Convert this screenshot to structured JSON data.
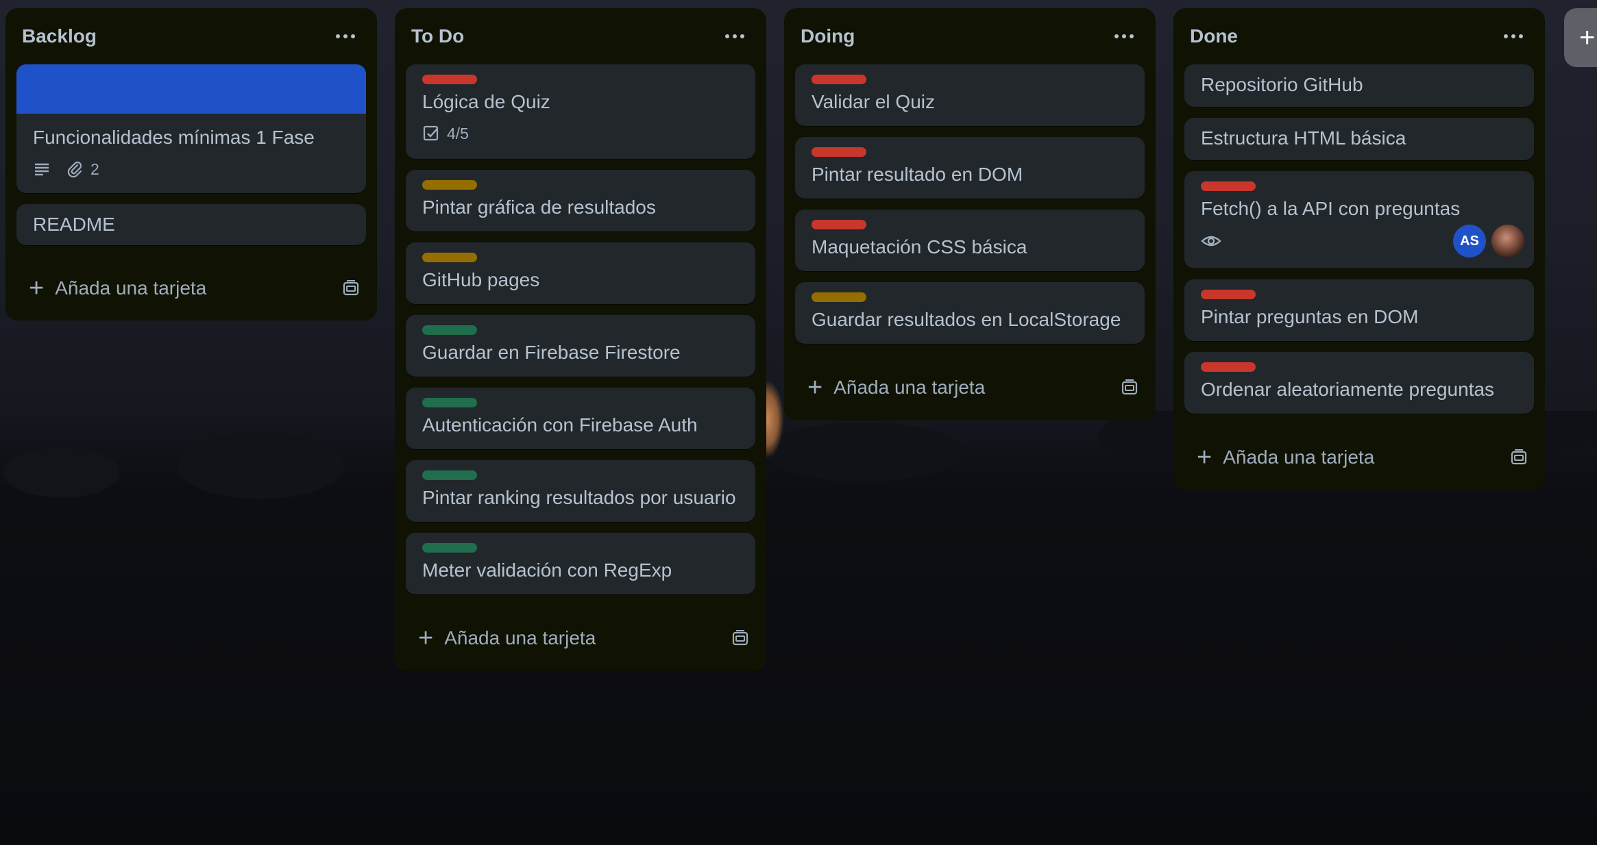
{
  "lists": [
    {
      "title": "Backlog",
      "cover_card": {
        "title": "Funcionalidades mínimas 1 Fase",
        "attachments": "2",
        "cover_color": "#1f52c9"
      },
      "cards": [
        {
          "title": "README"
        }
      ],
      "add_card_label": "Añada una tarjeta"
    },
    {
      "title": "To Do",
      "cards": [
        {
          "title": "Lógica de Quiz",
          "label": "red",
          "checklist": "4/5"
        },
        {
          "title": "Pintar gráfica de resultados",
          "label": "yellow"
        },
        {
          "title": "GitHub pages",
          "label": "yellow"
        },
        {
          "title": "Guardar en Firebase Firestore",
          "label": "green"
        },
        {
          "title": "Autenticación con Firebase Auth",
          "label": "green"
        },
        {
          "title": "Pintar ranking resultados por usuario",
          "label": "green"
        },
        {
          "title": "Meter validación con RegExp",
          "label": "green"
        }
      ],
      "add_card_label": "Añada una tarjeta"
    },
    {
      "title": "Doing",
      "cards": [
        {
          "title": "Validar el Quiz",
          "label": "red"
        },
        {
          "title": "Pintar resultado en DOM",
          "label": "red"
        },
        {
          "title": "Maquetación CSS básica",
          "label": "red"
        },
        {
          "title": "Guardar resultados en LocalStorage",
          "label": "yellow"
        }
      ],
      "add_card_label": "Añada una tarjeta"
    },
    {
      "title": "Done",
      "cards": [
        {
          "title": "Repositorio GitHub"
        },
        {
          "title": "Estructura HTML básica"
        },
        {
          "title": "Fetch() a la API con preguntas",
          "label": "red",
          "watching": true,
          "member_initials": "AS"
        },
        {
          "title": "Pintar preguntas en DOM",
          "label": "red"
        },
        {
          "title": "Ordenar aleatoriamente preguntas",
          "label": "red"
        }
      ],
      "add_card_label": "Añada una tarjeta"
    }
  ],
  "add_list_icon": "+",
  "colors": {
    "list_bg": "#101204",
    "card_bg": "#22272b",
    "label_red": "#c9372c",
    "label_yellow": "#946f00",
    "label_green": "#216e4e",
    "avatar_blue": "#1f52c9"
  }
}
